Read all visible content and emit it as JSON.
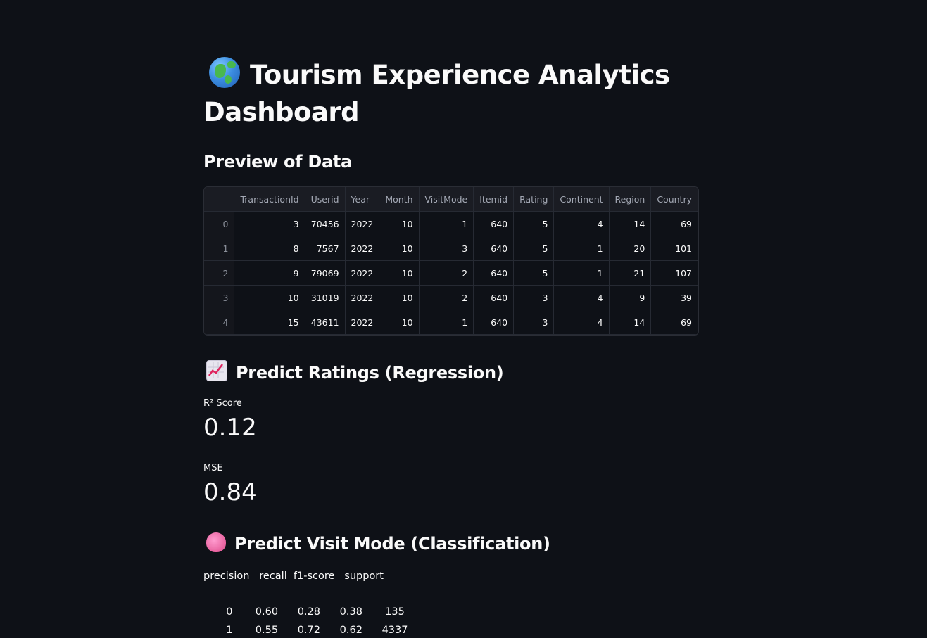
{
  "page": {
    "title": "Tourism Experience Analytics Dashboard",
    "title_icon": "globe-icon"
  },
  "preview": {
    "heading": "Preview of Data",
    "columns": [
      "",
      "TransactionId",
      "Userid",
      "Year",
      "Month",
      "VisitMode",
      "Itemid",
      "Rating",
      "Continent",
      "Region",
      "Country"
    ],
    "rows": [
      [
        "0",
        "3",
        "70456",
        "2022",
        "10",
        "1",
        "640",
        "5",
        "4",
        "14",
        "69"
      ],
      [
        "1",
        "8",
        "7567",
        "2022",
        "10",
        "3",
        "640",
        "5",
        "1",
        "20",
        "101"
      ],
      [
        "2",
        "9",
        "79069",
        "2022",
        "10",
        "2",
        "640",
        "5",
        "1",
        "21",
        "107"
      ],
      [
        "3",
        "10",
        "31019",
        "2022",
        "10",
        "2",
        "640",
        "3",
        "4",
        "9",
        "39"
      ],
      [
        "4",
        "15",
        "43611",
        "2022",
        "10",
        "1",
        "640",
        "3",
        "4",
        "14",
        "69"
      ]
    ]
  },
  "regression": {
    "heading": "Predict Ratings (Regression)",
    "icon": "chart-increasing-icon",
    "metrics": [
      {
        "label": "R² Score",
        "value": "0.12"
      },
      {
        "label": "MSE",
        "value": "0.84"
      }
    ]
  },
  "classification": {
    "heading": "Predict Visit Mode (Classification)",
    "icon": "brain-icon",
    "report_header": "precision   recall  f1-score   support",
    "report_rows": [
      "       0       0.60      0.28      0.38       135",
      "       1       0.55      0.72      0.62      4337"
    ]
  }
}
